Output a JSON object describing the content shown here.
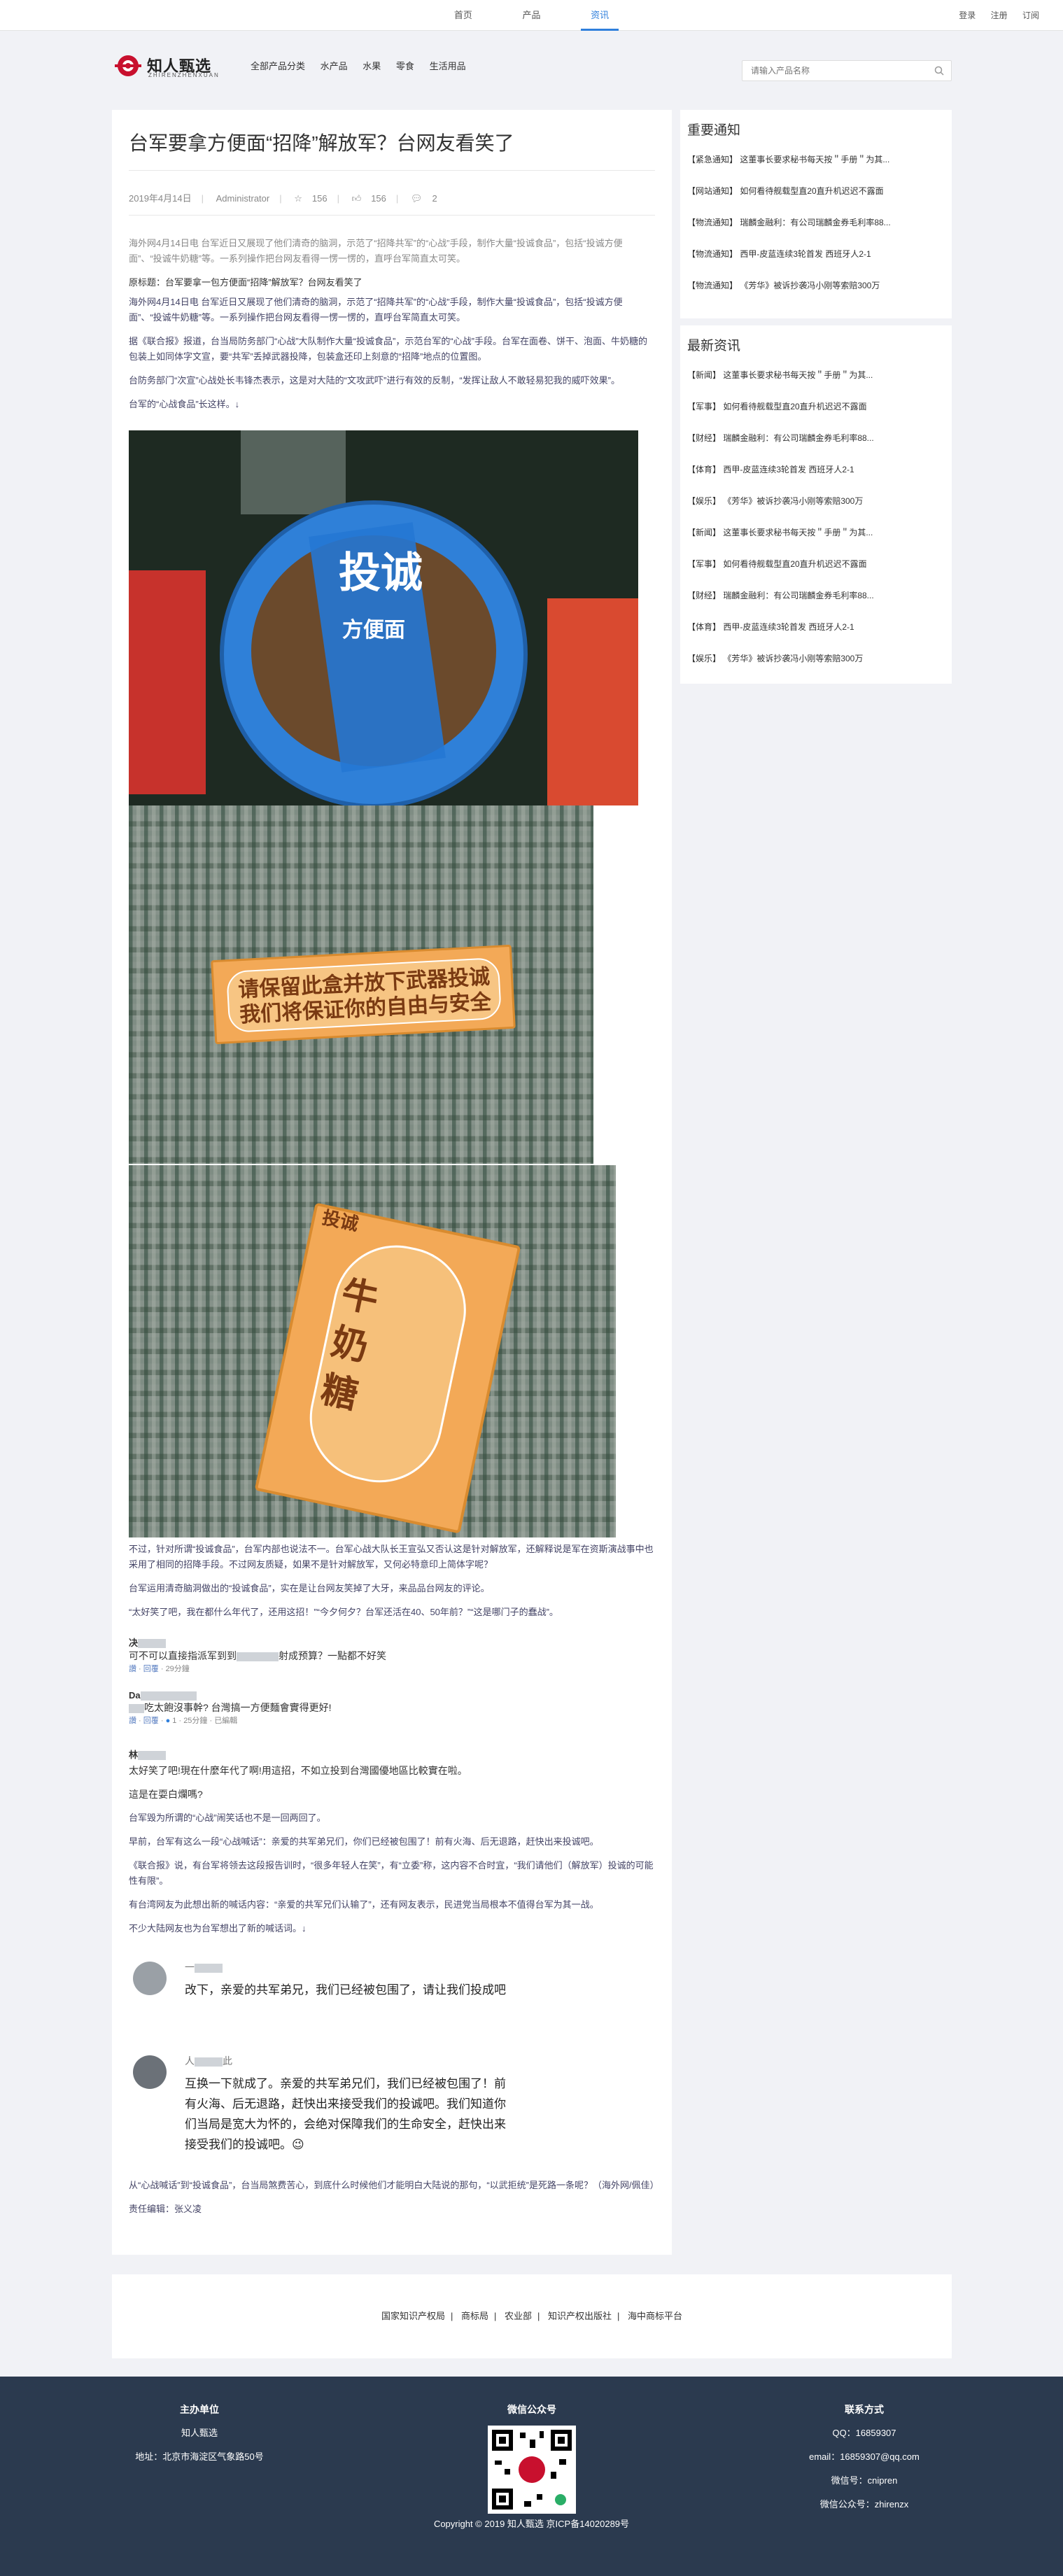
{
  "topnav": {
    "items": [
      "首页",
      "产品",
      "资讯"
    ],
    "active": "资讯",
    "right_links": [
      "登录",
      "注册",
      "订阅"
    ]
  },
  "header": {
    "logo_text": "知人甄选",
    "logo_sub": "ZHIRENZHENXUAN",
    "categories": [
      "全部产品分类",
      "水产品",
      "水果",
      "零食",
      "生活用品"
    ],
    "search_placeholder": "请输入产品名称"
  },
  "article": {
    "title": "台军要拿方便面“招降”解放军？台网友看笑了",
    "date": "2019年4月14日",
    "author": "Administrator",
    "stars": "156",
    "likes": "156",
    "comments": "2",
    "paragraphs": [
      "海外网4月14日电 台军近日又展现了他们清奇的脑洞，示范了“招降共军”的“心战”手段，制作大量“投诚食品”，包括“投诚方便面”、“投诚牛奶糖”等。一系列操作把台网友看得一愣一愣的，直呼台军简直太可笑。",
      "原标题：台军要拿一包方便面“招降”解放军？台网友看笑了",
      "海外网4月14日电 台军近日又展现了他们清奇的脑洞，示范了“招降共军”的“心战”手段，制作大量“投诚食品”，包括“投诚方便面”、“投诚牛奶糖”等。一系列操作把台网友看得一愣一愣的，直呼台军简直太可笑。",
      "据《联合报》报道，台当局防务部门“心战”大队制作大量“投诚食品”，示范台军的“心战”手段。台军在面卷、饼干、泡面、牛奶糖的包装上如同体字文宣，要“共军”丢掉武器投降，包装盒还印上刻意的“招降”地点的位置图。",
      "台防务部门“次宣”心战处长韦锋杰表示，这是对大陆的“文攻武吓”进行有效的反制，“发挥让敌人不敢轻易犯我的威吓效果”。",
      "台军的“心战食品”长这样。↓"
    ],
    "photo1_brand": "投诚",
    "photo1_sub": "方便面",
    "photo2_text": "请保留此盒并放下武器投诚 我们将保证你的自由与安全",
    "photo3_label": "投诚",
    "photo3_text": "牛奶糖",
    "after_paragraphs": [
      "不过，针对所谓“投诚食品”，台军内部也说法不一。台军心战大队长王宣弘又否认这是针对解放军，还解释说是军在资斯演战事中也采用了相同的招降手段。不过网友质疑，如果不是针对解放军，又何必特意印上简体字呢？",
      "台军运用清奇脑洞做出的“投诚食品”，实在是让台网友笑掉了大牙，来品品台网友的评论。",
      "“太好笑了吧，我在都什么年代了，还用这招！”“今夕何夕？台军还活在40、50年前？”“这是哪门子的蠢战”。"
    ],
    "comments_list": [
      {
        "name": "决",
        "text": "可不可以直接指派军到到",
        "text2": "射成预算？一點都不好笑",
        "meta_like": "讚",
        "meta_reply": "回覆",
        "meta_time": "29分鐘"
      },
      {
        "name": "Da",
        "text": "吃太飽沒事幹? 台灣搞一方便麵會實得更好!",
        "meta_like": "讚",
        "meta_reply": "回覆",
        "meta_count": "1",
        "meta_time": "25分鐘 · 已編輯"
      },
      {
        "name": "林",
        "text": "太好笑了吧!現在什麼年代了啊!用這招，不如立投到台灣國優地區比較實在啦。",
        "text2": "這是在耍白爛嗎?"
      }
    ],
    "after2_paragraphs": [
      "台军毁为所谓的“心战”闹笑话也不是一回两回了。",
      "早前，台军有这么一段“心战喊话”：亲爱的共军弟兄们，你们已经被包围了！前有火海、后无退路，赶快出来投诚吧。",
      "《联合报》说，有台军将领去这段报告训时，“很多年轻人在笑”，有“立委”称，这内容不合时宜，“我们请他们（解放军）投诚的可能性有限”。",
      "有台湾网友为此想出新的喊话内容：“亲爱的共军兄们认输了”，还有网友表示，民进党当局根本不值得台军为其一战。",
      "不少大陆网友也为台军想出了新的喊话词。↓"
    ],
    "wb1_name": "一",
    "wb1_name_suffix": "",
    "wb1_text": "改下，亲爱的共军弟兄，我们已经被包围了，请让我们投成吧",
    "wb2_name": "人",
    "wb2_name_suffix": "此",
    "wb2_text": "互换一下就成了。亲爱的共军弟兄们，我们已经被包围了！前有火海、后无退路，赶快出来接受我们的投诚吧。我们知道你们当局是宽大为怀的，会绝对保障我们的生命安全，赶快出来接受我们的投诚吧。",
    "wb2_emoji": "😉",
    "closing": "从“心战喊话”到“投诚食品”，台当局煞费苦心，到底什么时候他们才能明白大陆说的那句，“以武拒统”是死路一条呢？（海外网/佩佳）",
    "editor": "责任编辑：张义凌"
  },
  "sidebar": {
    "notice_title": "重要通知",
    "notices": [
      "【紧急通知】 这董事长要求秘书每天按＂手册＂为其...",
      "【网站通知】 如何看待舰载型直20直升机迟迟不露面",
      "【物流通知】 瑞麟金融利：有公司瑞麟金券毛利率88...",
      "【物流通知】 西甲-皮蓝连续3轮首发 西班牙人2-1",
      "【物流通知】 《芳华》被诉抄袭冯小刚等索赔300万"
    ],
    "news_title": "最新资讯",
    "news": [
      "【新闻】 这董事长要求秘书每天按＂手册＂为其...",
      "【军事】 如何看待舰载型直20直升机迟迟不露面",
      "【财经】 瑞麟金融利：有公司瑞麟金券毛利率88...",
      "【体育】 西甲-皮蓝连续3轮首发 西班牙人2-1",
      "【娱乐】 《芳华》被诉抄袭冯小刚等索赔300万",
      "【新闻】 这董事长要求秘书每天按＂手册＂为其...",
      "【军事】 如何看待舰载型直20直升机迟迟不露面",
      "【财经】 瑞麟金融利：有公司瑞麟金券毛利率88...",
      "【体育】 西甲-皮蓝连续3轮首发 西班牙人2-1",
      "【娱乐】 《芳华》被诉抄袭冯小刚等索赔300万"
    ]
  },
  "links": [
    "国家知识产权局",
    "商标局",
    "农业部",
    "知识产权出版社",
    "海中商标平台"
  ],
  "footer": {
    "sponsor_title": "主办单位",
    "sponsor_name": "知人甄选",
    "address": "地址：北京市海淀区气象路50号",
    "wechat_title": "微信公众号",
    "contact_title": "联系方式",
    "qq": "QQ：16859307",
    "email": "email：16859307@qq.com",
    "wechat_id": "微信号：cnipren",
    "wechat_pub": "微信公众号：zhirenzx",
    "copyright": "Copyright © 2019 知人甄选 京ICP备14020289号"
  }
}
